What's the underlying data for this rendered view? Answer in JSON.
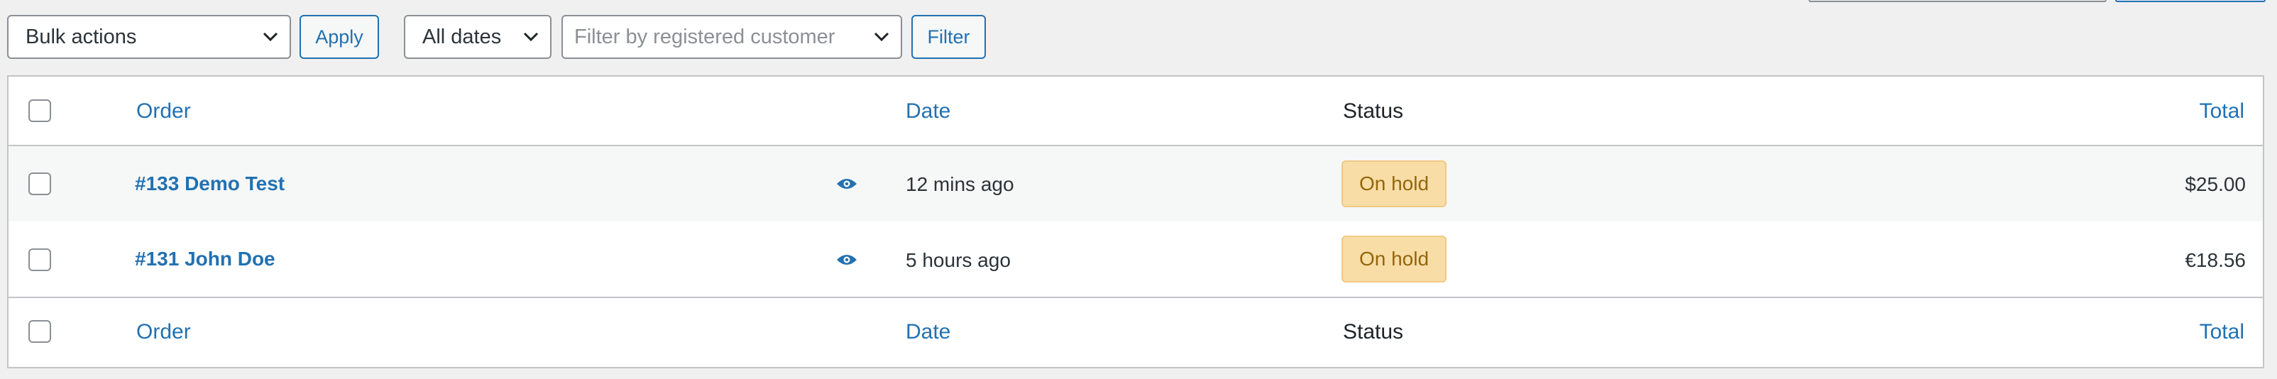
{
  "toolbar": {
    "bulk_actions": "Bulk actions",
    "apply": "Apply",
    "all_dates": "All dates",
    "customer_placeholder": "Filter by registered customer",
    "filter": "Filter"
  },
  "table": {
    "headers": {
      "order": "Order",
      "date": "Date",
      "status": "Status",
      "total": "Total"
    },
    "rows": [
      {
        "order": "#133 Demo Test",
        "date": "12 mins ago",
        "status": "On hold",
        "total": "$25.00"
      },
      {
        "order": "#131 John Doe",
        "date": "5 hours ago",
        "status": "On hold",
        "total": "€18.56"
      }
    ]
  },
  "colors": {
    "accent": "#2271b1",
    "status_on_hold_bg": "#f8dda7",
    "status_on_hold_text": "#94660c"
  },
  "icons": {
    "preview": "eye-icon",
    "dropdown": "chevron-down-icon"
  }
}
